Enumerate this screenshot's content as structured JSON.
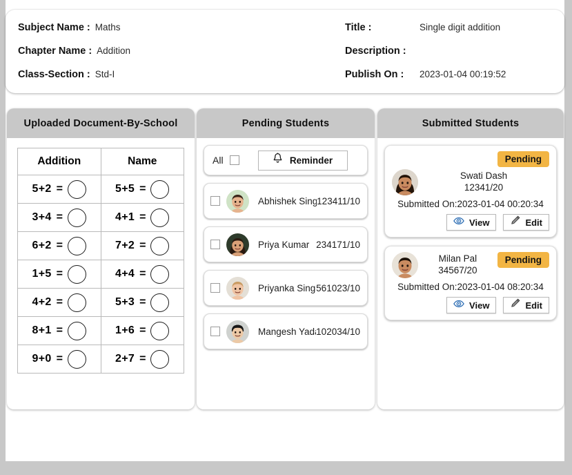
{
  "header": {
    "left_fields": [
      {
        "label": "Subject Name :",
        "value": "Maths"
      },
      {
        "label": "Chapter Name :",
        "value": "Addition"
      },
      {
        "label": "Class-Section :",
        "value": "Std-I"
      }
    ],
    "right_fields": [
      {
        "label": "Title :",
        "value": "Single digit addition"
      },
      {
        "label": "Description :",
        "value": ""
      },
      {
        "label": "Publish On :",
        "value": "2023-01-04 00:19:52"
      }
    ]
  },
  "document_panel": {
    "title": "Uploaded Document-By-School",
    "columns": [
      "Addition",
      "Name"
    ],
    "rows": [
      {
        "left": "5+2",
        "right": "5+5"
      },
      {
        "left": "3+4",
        "right": "4+1"
      },
      {
        "left": "6+2",
        "right": "7+2"
      },
      {
        "left": "1+5",
        "right": "4+4"
      },
      {
        "left": "4+2",
        "right": "5+3"
      },
      {
        "left": "8+1",
        "right": "1+6"
      },
      {
        "left": "9+0",
        "right": "2+7"
      }
    ],
    "equals_sign": "="
  },
  "pending_panel": {
    "title": "Pending Students",
    "all_label": "All",
    "reminder_label": "Reminder",
    "reminder_icon": "bell-icon",
    "students": [
      {
        "name": "Abhishek Singh",
        "roll": "123411/10",
        "avatar": "boy-smiling"
      },
      {
        "name": "Priya Kumar",
        "roll": "234171/10",
        "avatar": "girl-smiling"
      },
      {
        "name": "Priyanka Singh",
        "roll": "561023/10",
        "avatar": "toddler-girl"
      },
      {
        "name": "Mangesh Yadav",
        "roll": "102034/10",
        "avatar": "boy-dark-hair"
      }
    ]
  },
  "submitted_panel": {
    "title": "Submitted Students",
    "submitted_prefix": "Submitted On:",
    "view_label": "View",
    "edit_label": "Edit",
    "view_icon": "eye-icon",
    "edit_icon": "pencil-icon",
    "students": [
      {
        "name": "Swati Dash",
        "roll": "12341/20",
        "status": "Pending",
        "submitted_on": "Submitted On:2023-01-04 00:20:34",
        "badge_position": "top-right",
        "avatar": "girl-long-hair"
      },
      {
        "name": "Milan Pal",
        "roll": "34567/20",
        "status": "Pending",
        "submitted_on": "Submitted On:2023-01-04 08:20:34",
        "badge_position": "inline",
        "avatar": "boy-short-hair"
      }
    ]
  },
  "colors": {
    "page_background": "#c8c8c8",
    "panel_header": "#c8c8c8",
    "badge_pending": "#f2b544",
    "view_icon": "#2f6fb5",
    "card_surface": "#ffffff"
  }
}
